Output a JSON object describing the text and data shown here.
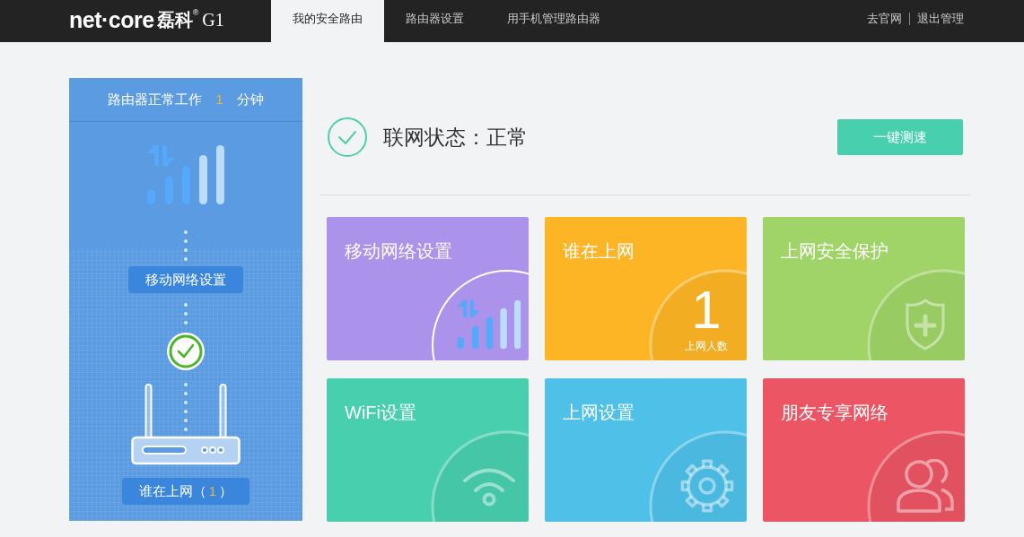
{
  "header": {
    "logo": {
      "wordmark": "net·core",
      "cn_name": "磊科",
      "mark": "®",
      "model": "G1"
    },
    "tabs": [
      {
        "label": "我的安全路由",
        "selected": true
      },
      {
        "label": "路由器设置",
        "selected": false
      },
      {
        "label": "用手机管理路由器",
        "selected": false
      }
    ],
    "links": [
      "去官网",
      "退出管理"
    ]
  },
  "status_panel": {
    "uptime": {
      "prefix": "路由器正常工作",
      "value": "1",
      "suffix": "分钟"
    },
    "network_button": "移动网络设置",
    "clients_button": {
      "prefix": "谁在上网（",
      "count": "1",
      "suffix": "）"
    }
  },
  "internet": {
    "status": "联网状态：正常",
    "speed_test_button": "一键测速"
  },
  "tiles": [
    {
      "kind": "signal",
      "title": "移动网络设置",
      "color": "#ab92eb",
      "highlighted": true
    },
    {
      "kind": "count",
      "title": "谁在上网",
      "count": "1",
      "count_label": "上网人数",
      "color": "#fdb525",
      "highlighted": false
    },
    {
      "kind": "shield",
      "title": "上网安全保护",
      "color": "#a0d468",
      "highlighted": false
    },
    {
      "kind": "wifi",
      "title": "WiFi设置",
      "color": "#48cfad",
      "highlighted": false
    },
    {
      "kind": "gear",
      "title": "上网设置",
      "color": "#4fc1e9",
      "highlighted": false
    },
    {
      "kind": "people",
      "title": "朋友专享网络",
      "color": "#ec5564",
      "highlighted": false
    }
  ]
}
